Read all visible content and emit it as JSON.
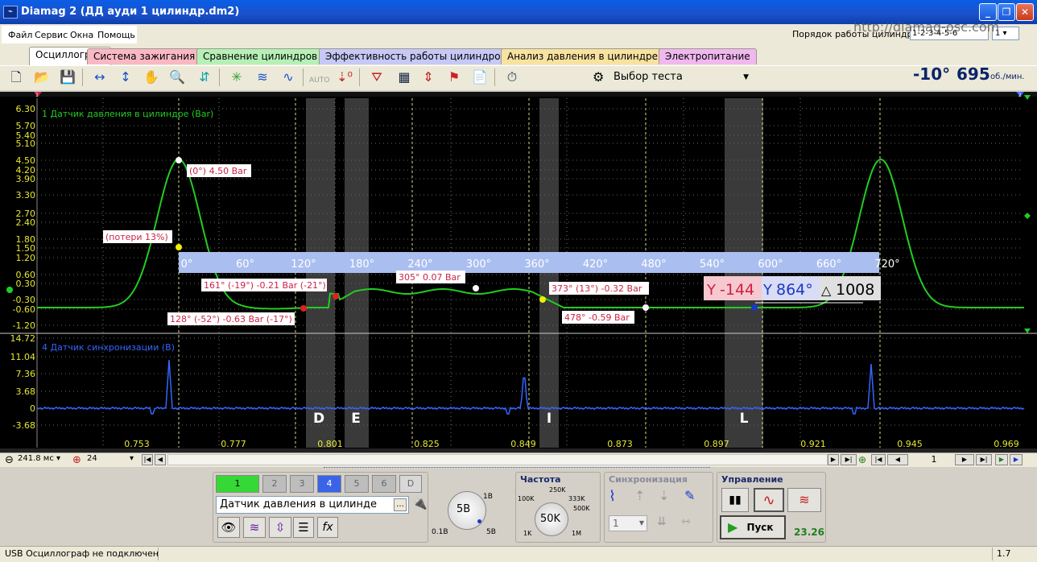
{
  "window": {
    "title": "Diamag 2 (ДД ауди 1 цилиндр.dm2)",
    "icon": "app-icon"
  },
  "menu": [
    "Файл",
    "Сервис",
    "Окна",
    "Помощь"
  ],
  "firing": {
    "label": "Порядок работы цилиндров",
    "value": "1-2-3-4-5-6",
    "cyl": "1"
  },
  "watermark": "http://diamag-osc.com",
  "tabs": [
    {
      "label": "Осциллограф",
      "color": "#ece9d8"
    },
    {
      "label": "Система зажигания",
      "color": "#f9b8c4"
    },
    {
      "label": "Сравнение цилиндров",
      "color": "#b6f0b6"
    },
    {
      "label": "Эффективность работы цилиндров",
      "color": "#c6c8f6"
    },
    {
      "label": "Анализ давления в цилиндре",
      "color": "#f8e2a0"
    },
    {
      "label": "Электропитание",
      "color": "#f0b8ee"
    }
  ],
  "toolbar": {
    "test_select": "Выбор теста",
    "angle": "-10°",
    "rpm": "695",
    "rpm_unit": "об./мин.",
    "auto_label": "AUTO"
  },
  "scope": {
    "ch1_label": "1 Датчик давления в цилиндре (Bar)",
    "ch4_label": "4 Датчик синхронизации (В)",
    "ch1_ticks": [
      "6.30",
      "5.70",
      "5.40",
      "5.10",
      "4.50",
      "4.20",
      "3.90",
      "3.30",
      "2.70",
      "2.40",
      "1.80",
      "1.50",
      "1.20",
      "0.60",
      "0.30",
      "-0.30",
      "-0.60",
      "-1.20"
    ],
    "ch4_ticks": [
      "14.72",
      "11.04",
      "7.36",
      "3.68",
      "0",
      "-3.68"
    ],
    "time_ticks": [
      "0.753",
      "0.777",
      "0.801",
      "0.825",
      "0.849",
      "0.873",
      "0.897",
      "0.921",
      "0.945",
      "0.969"
    ],
    "degree_ticks": [
      "0°",
      "60°",
      "120°",
      "180°",
      "240°",
      "300°",
      "360°",
      "420°",
      "480°",
      "540°",
      "600°",
      "660°",
      "720°"
    ],
    "zone_labels": [
      "D",
      "E",
      "I",
      "L"
    ],
    "annotations": [
      "(0°) 4.50 Bar",
      "(потери 13%)",
      "161° (-19°) -0.21 Bar (-21°)",
      "128° (-52°) -0.63 Bar (-17°)",
      "305° 0.07 Bar",
      "373° (13°) -0.32 Bar",
      "478° -0.59 Bar"
    ],
    "cursor_a": "-144",
    "cursor_b": "864°",
    "cursor_delta": "1008",
    "marker_left": "1",
    "marker_right": "2",
    "colors": {
      "ch1": "#22cc22",
      "ch4": "#3366ff",
      "ann_text": "#cc2244"
    }
  },
  "nav": {
    "timebase": "241.8 мс",
    "trigger": "24",
    "page": "1"
  },
  "channels": {
    "buttons": [
      "1",
      "2",
      "3",
      "4",
      "5",
      "6",
      "D"
    ],
    "sensor": "Датчик давления в цилинде",
    "voltage": "5В",
    "v_min": "0.1В",
    "v_1": "1В",
    "v_max": "5В"
  },
  "frequency": {
    "title": "Частота",
    "value": "50K",
    "marks": [
      "100K",
      "250K",
      "333K",
      "500K",
      "1K",
      "1M"
    ]
  },
  "sync": {
    "title": "Синхронизация",
    "select": "1"
  },
  "control": {
    "title": "Управление",
    "start": "Пуск",
    "value": "23.26"
  },
  "status": {
    "text": "USB Осциллограф не подключен",
    "version": "1.7"
  }
}
